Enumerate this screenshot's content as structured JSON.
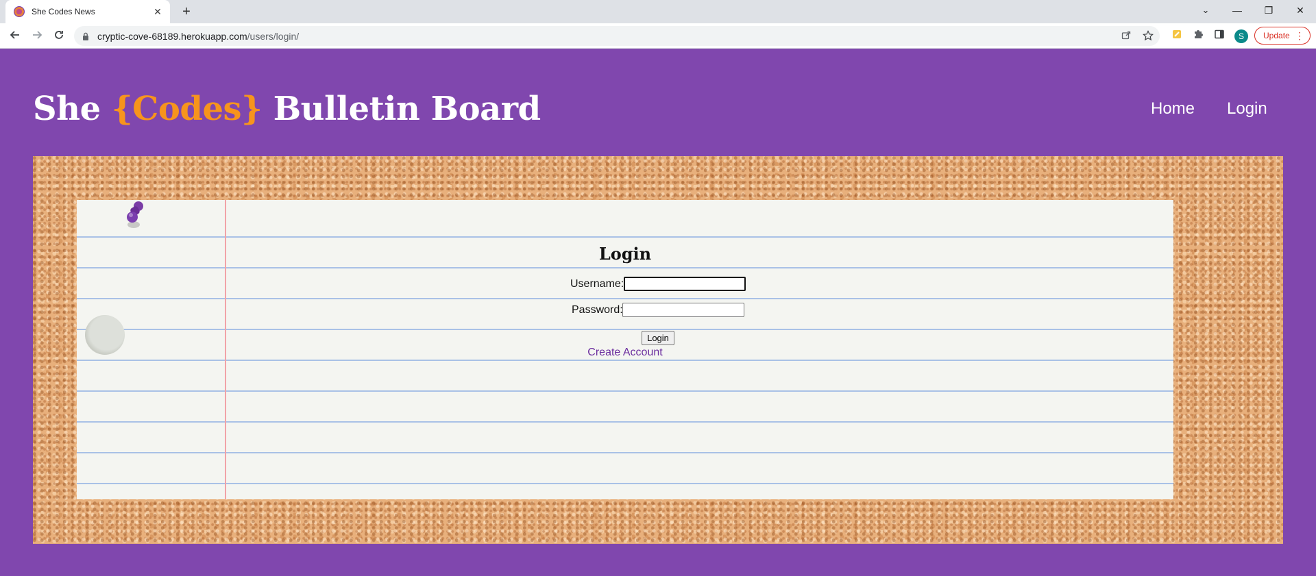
{
  "browser": {
    "tab_title": "She Codes News",
    "tab_close": "✕",
    "new_tab": "+",
    "url_host": "cryptic-cove-68189.herokuapp.com",
    "url_path": "/users/login/",
    "profile_initial": "S",
    "update_label": "Update",
    "window_controls": {
      "tab_search": "⌄",
      "minimize": "—",
      "restore": "❐",
      "close": "✕"
    }
  },
  "site": {
    "brand_prefix": "She ",
    "brand_accent": "{Codes}",
    "brand_suffix": " Bulletin Board",
    "nav": [
      {
        "label": "Home"
      },
      {
        "label": "Login"
      }
    ]
  },
  "login_form": {
    "title": "Login",
    "username_label": "Username:",
    "password_label": "Password:",
    "submit_label": "Login",
    "create_account_link": "Create Account"
  },
  "colors": {
    "page_background": "#8047ae",
    "brand_accent": "#f7941d",
    "link": "#6a2c9e",
    "update_button": "#d93025"
  }
}
